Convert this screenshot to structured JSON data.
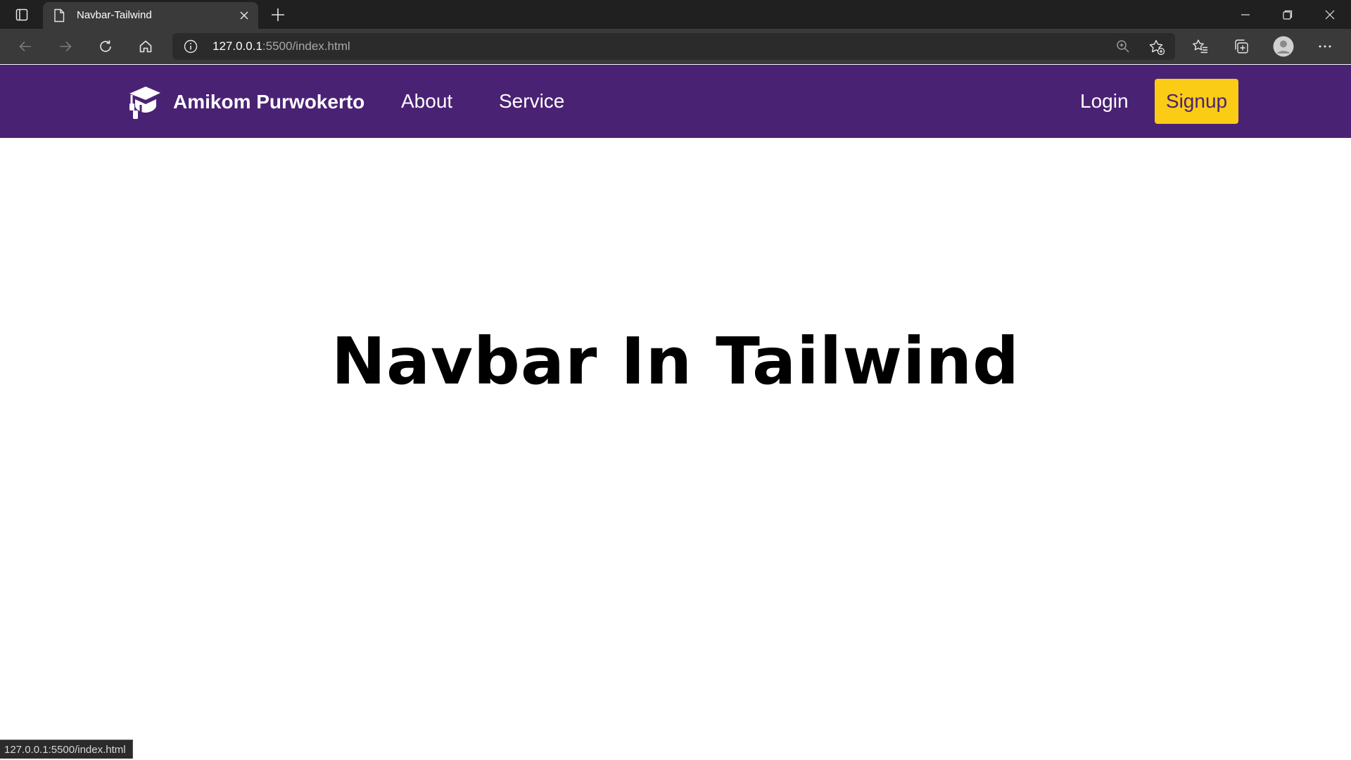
{
  "browser": {
    "tab": {
      "title": "Navbar-Tailwind"
    },
    "address": {
      "host": "127.0.0.1",
      "port_path": ":5500/index.html"
    },
    "status_url": "127.0.0.1:5500/index.html",
    "icons": {
      "tab_actions": "tab-actions-icon",
      "favicon": "document-icon",
      "close_tab": "close-icon",
      "new_tab": "plus-icon",
      "back": "back-arrow-icon",
      "forward": "forward-arrow-icon",
      "refresh": "refresh-icon",
      "home": "home-icon",
      "site_info": "info-icon",
      "zoom": "zoom-in-icon",
      "add_favorite": "star-plus-icon",
      "favorites": "favorites-icon",
      "collections": "collections-icon",
      "profile": "profile-avatar-icon",
      "more": "more-icon"
    }
  },
  "navbar": {
    "brand": "Amikom Purwokerto",
    "links": [
      "About",
      "Service"
    ],
    "login": "Login",
    "signup": "Signup",
    "colors": {
      "background": "#4a2274",
      "signup_bg": "#facc15"
    }
  },
  "hero": {
    "title": "Navbar In Tailwind"
  }
}
